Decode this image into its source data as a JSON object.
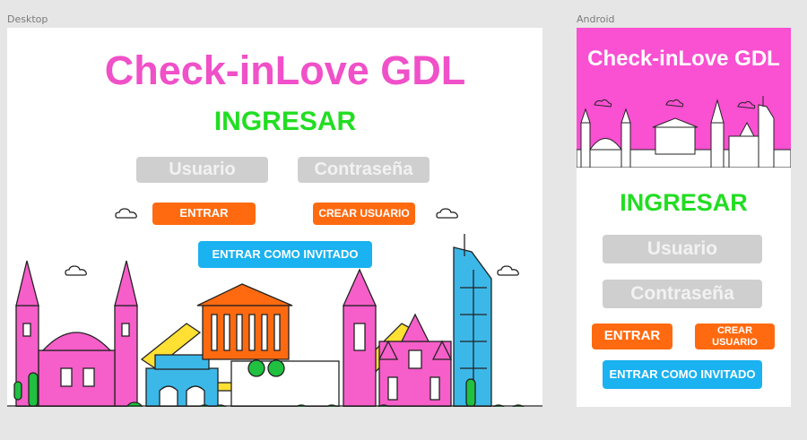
{
  "frames": {
    "desktop_label": "Desktop",
    "android_label": "Android"
  },
  "app": {
    "title": "Check-inLove GDL",
    "heading": "INGRESAR"
  },
  "form": {
    "username_placeholder": "Usuario",
    "password_placeholder": "Contraseña",
    "login_button": "ENTRAR",
    "register_button": "CREAR USUARIO",
    "guest_button": "ENTRAR COMO INVITADO"
  },
  "colors": {
    "title_pink": "#f050c8",
    "heading_green": "#22dd22",
    "button_orange": "#ff6a10",
    "button_blue": "#1ab2f0",
    "input_grey": "#cfcfcf",
    "header_pink": "#fa50d2"
  }
}
